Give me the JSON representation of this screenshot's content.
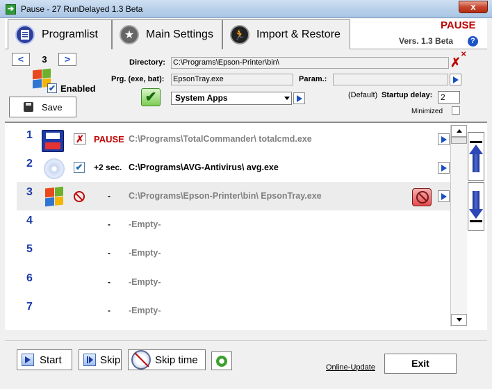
{
  "window": {
    "title": "Pause - 27  RunDelayed 1.3 Beta",
    "close_glyph": "x"
  },
  "tabs": [
    {
      "label": "Programlist",
      "icon": "document-list-icon"
    },
    {
      "label": "Main Settings",
      "icon": "star-icon"
    },
    {
      "label": "Import & Restore",
      "icon": "running-man-icon"
    }
  ],
  "header": {
    "status": "PAUSE",
    "version": "Vers. 1.3 Beta",
    "help_glyph": "?"
  },
  "editor": {
    "prev_glyph": "<",
    "next_glyph": ">",
    "index": "3",
    "enabled_label": "Enabled",
    "enabled_checked": true,
    "save_label": "Save",
    "directory_label": "Directory:",
    "directory_value": "C:\\Programs\\Epson-Printer\\bin\\",
    "program_label": "Prg. (exe, bat):",
    "program_value": "EpsonTray.exe",
    "param_label": "Param.:",
    "param_value": "",
    "group_value": "System Apps",
    "default_label": "(Default)",
    "startup_delay_label": "Startup delay:",
    "startup_delay_value": "2",
    "minimized_label": "Minimized",
    "minimized_checked": false
  },
  "list": [
    {
      "num": "1",
      "delay": "PAUSE",
      "path": "C:\\Programs\\TotalCommander\\ totalcmd.exe",
      "status": "paused"
    },
    {
      "num": "2",
      "delay": "+2 sec.",
      "path": "C:\\Programs\\AVG-Antivirus\\ avg.exe",
      "status": "enabled"
    },
    {
      "num": "3",
      "delay": "-",
      "path": "C:\\Programs\\Epson-Printer\\bin\\ EpsonTray.exe",
      "status": "disabled"
    },
    {
      "num": "4",
      "delay": "-",
      "path": "-Empty-",
      "status": "empty"
    },
    {
      "num": "5",
      "delay": "-",
      "path": "-Empty-",
      "status": "empty"
    },
    {
      "num": "6",
      "delay": "-",
      "path": "-Empty-",
      "status": "empty"
    },
    {
      "num": "7",
      "delay": "-",
      "path": "-Empty-",
      "status": "empty"
    }
  ],
  "footer": {
    "start_label": "Start",
    "skip_label": "Skip",
    "skip_time_label": "Skip time",
    "online_update_label": "Online-Update",
    "exit_label": "Exit"
  },
  "colors": {
    "accent": "#1a4fc0",
    "pause_red": "#c00000",
    "selected_row": "#ececec"
  }
}
